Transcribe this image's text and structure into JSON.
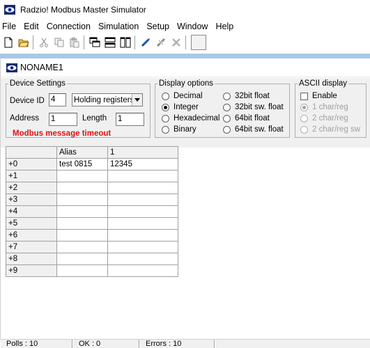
{
  "window": {
    "title": "Radzio! Modbus Master Simulator"
  },
  "menu": [
    "File",
    "Edit",
    "Connection",
    "Simulation",
    "Setup",
    "Window",
    "Help"
  ],
  "toolbar": {
    "icons": [
      "new-icon",
      "open-icon",
      "cut-icon",
      "copy-icon",
      "paste-icon",
      "tile-icon",
      "tile-horizontal-icon",
      "tile-vertical-icon",
      "connect-icon",
      "disconnect-icon",
      "tools-icon"
    ]
  },
  "child": {
    "title": "NONAME1"
  },
  "device_settings": {
    "legend": "Device Settings",
    "device_id_label": "Device ID",
    "device_id_value": "4",
    "register_type": "Holding registers",
    "address_label": "Address",
    "address_value": "1",
    "length_label": "Length",
    "length_value": "1",
    "error_message": "Modbus message timeout"
  },
  "display_options": {
    "legend": "Display options",
    "options": [
      {
        "label": "Decimal",
        "selected": false
      },
      {
        "label": "Integer",
        "selected": true
      },
      {
        "label": "Hexadecimal",
        "selected": false
      },
      {
        "label": "Binary",
        "selected": false
      },
      {
        "label": "32bit float",
        "selected": false
      },
      {
        "label": "32bit sw. float",
        "selected": false
      },
      {
        "label": "64bit float",
        "selected": false
      },
      {
        "label": "64bit sw. float",
        "selected": false
      }
    ]
  },
  "ascii_display": {
    "legend": "ASCII display",
    "enable_label": "Enable",
    "enabled": false,
    "options": [
      {
        "label": "1 char/reg",
        "selected": true
      },
      {
        "label": "2 char/reg",
        "selected": false
      },
      {
        "label": "2 char/reg sw",
        "selected": false
      }
    ]
  },
  "grid": {
    "columns": [
      "Alias",
      "1"
    ],
    "rows": [
      {
        "label": "+0",
        "alias": "test 0815",
        "value": "12345"
      },
      {
        "label": "+1",
        "alias": "",
        "value": ""
      },
      {
        "label": "+2",
        "alias": "",
        "value": ""
      },
      {
        "label": "+3",
        "alias": "",
        "value": ""
      },
      {
        "label": "+4",
        "alias": "",
        "value": ""
      },
      {
        "label": "+5",
        "alias": "",
        "value": ""
      },
      {
        "label": "+6",
        "alias": "",
        "value": ""
      },
      {
        "label": "+7",
        "alias": "",
        "value": ""
      },
      {
        "label": "+8",
        "alias": "",
        "value": ""
      },
      {
        "label": "+9",
        "alias": "",
        "value": ""
      }
    ]
  },
  "status": {
    "polls": "Polls : 10",
    "ok": "OK : 0",
    "errors": "Errors : 10"
  },
  "colors": {
    "error_text": "#e01010",
    "mdi_background": "#a8c8e8"
  }
}
